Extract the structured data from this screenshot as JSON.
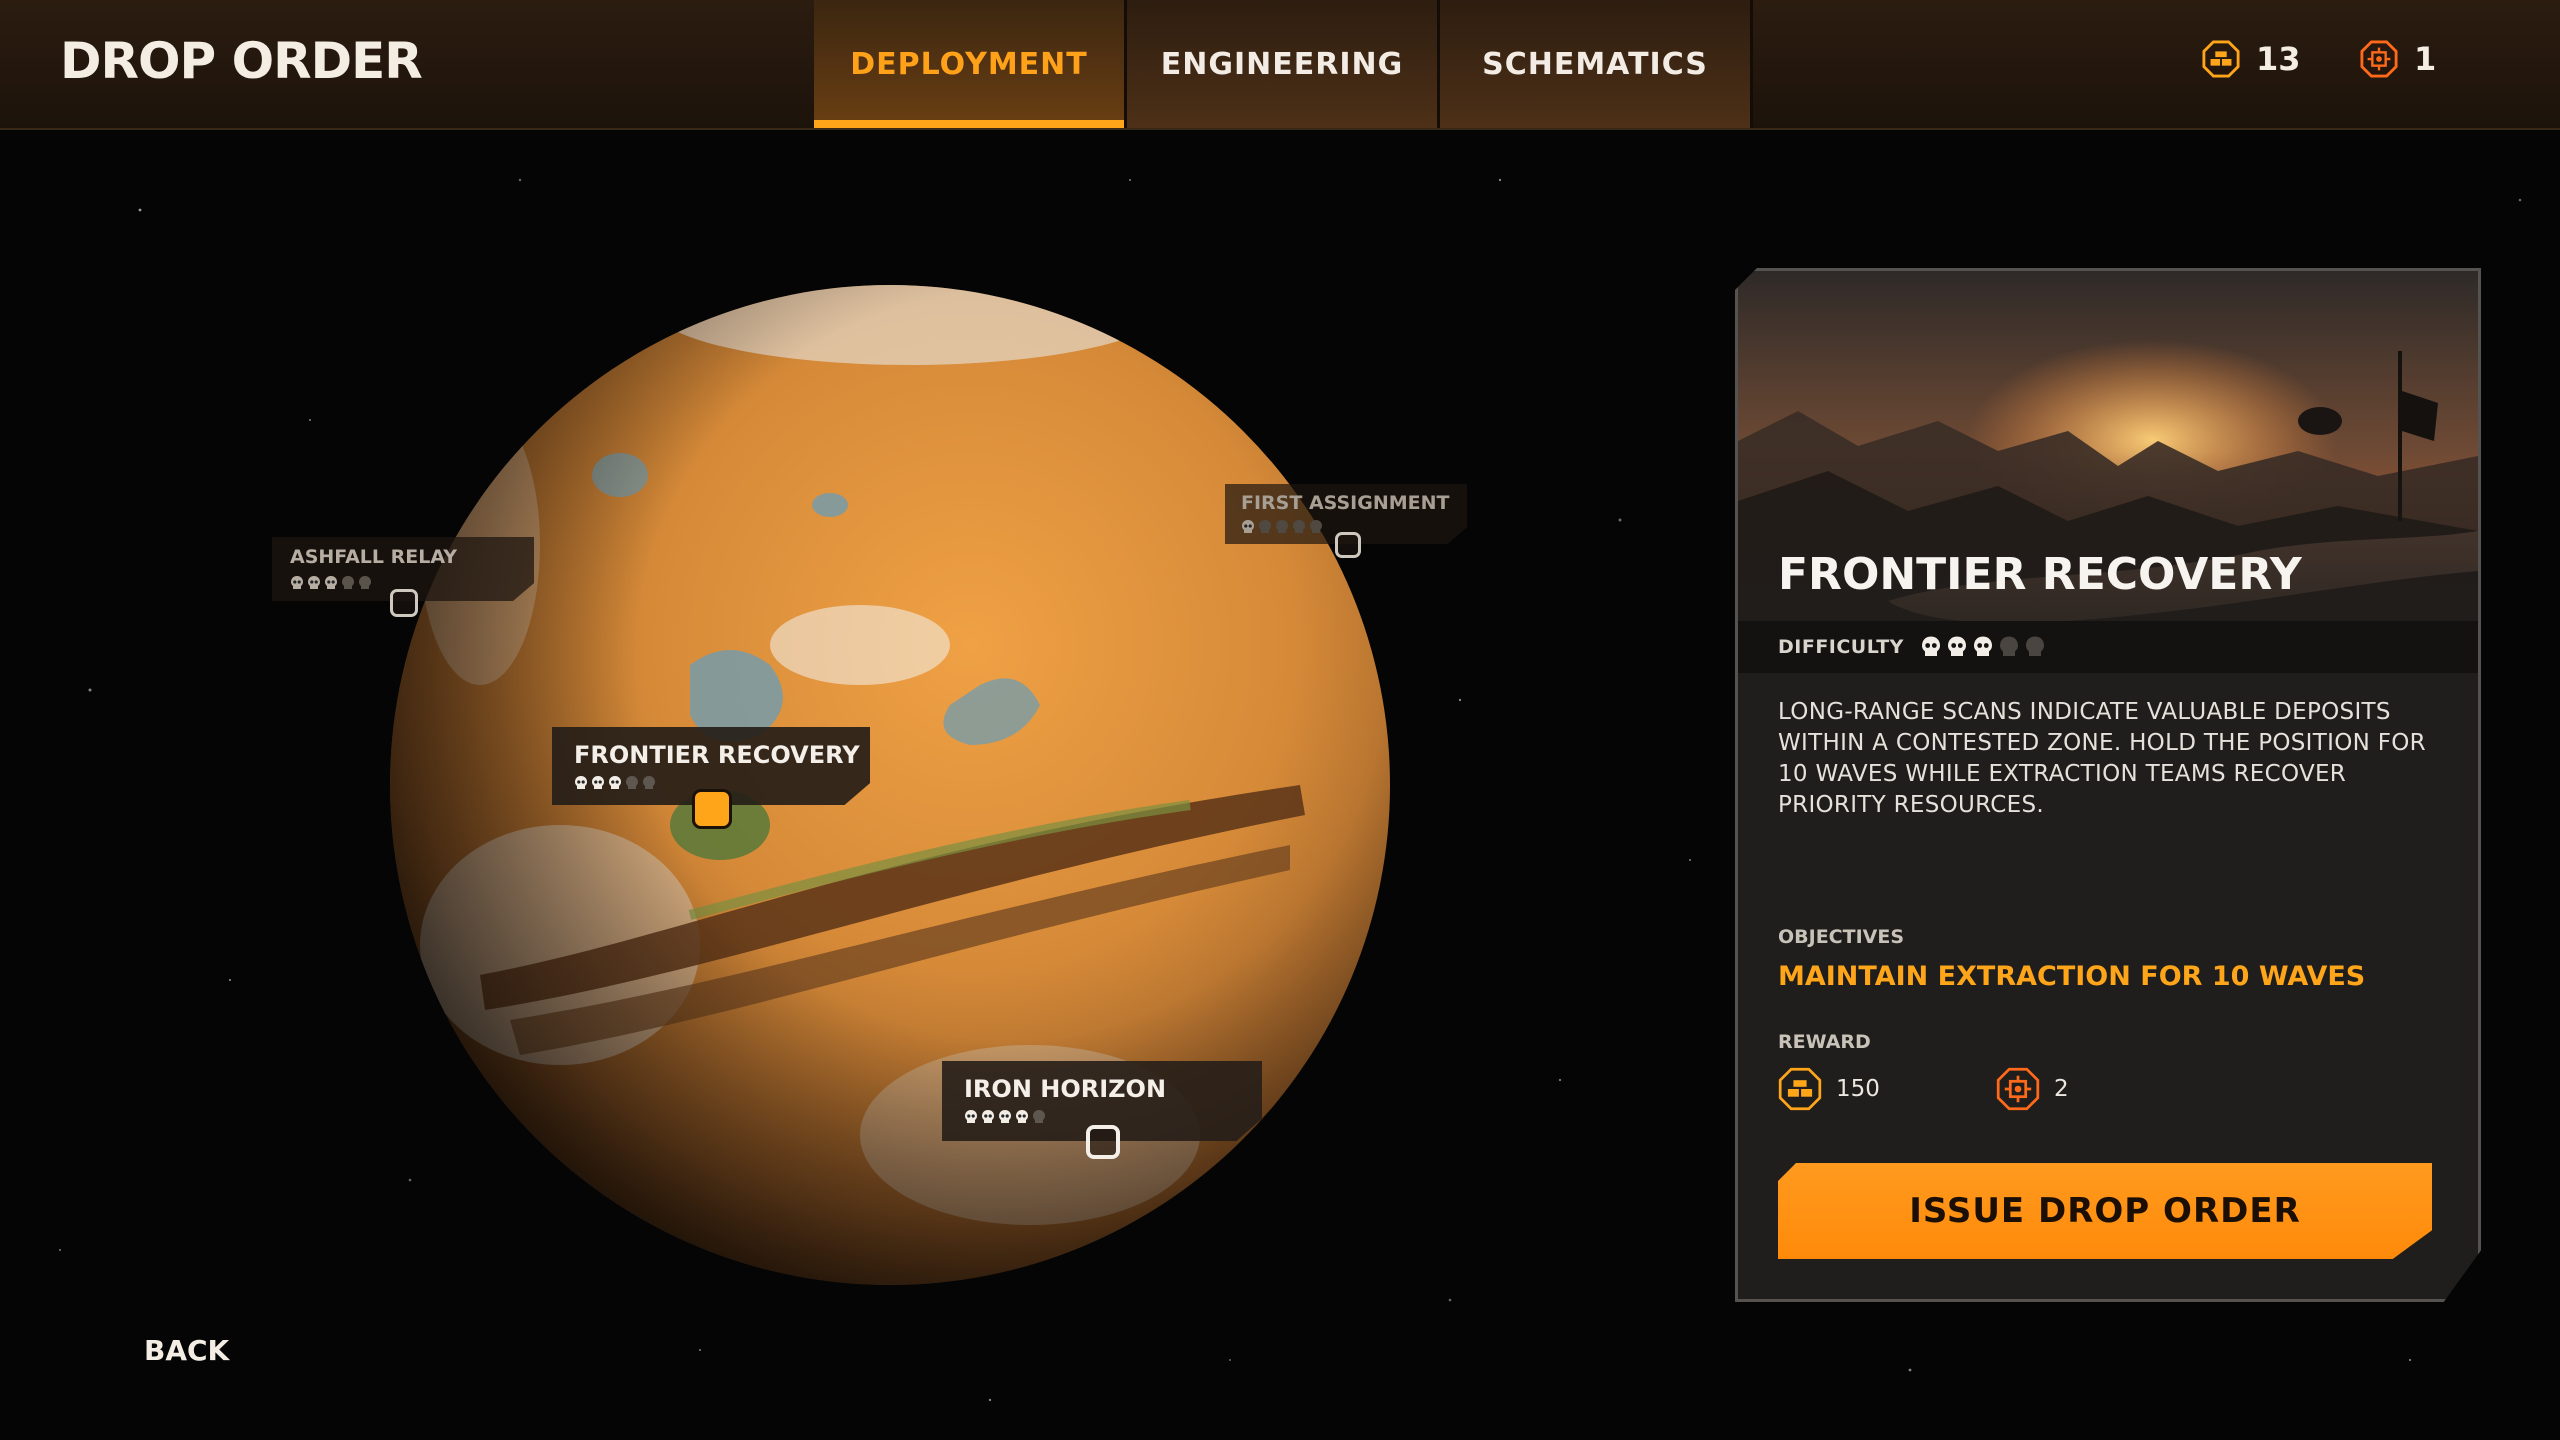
{
  "app": {
    "title": "DROP ORDER"
  },
  "tabs": [
    {
      "label": "DEPLOYMENT",
      "active": true
    },
    {
      "label": "ENGINEERING",
      "active": false
    },
    {
      "label": "SCHEMATICS",
      "active": false
    }
  ],
  "currencies": [
    {
      "icon": "gold-bars-icon",
      "value": "13",
      "color": "#ffa51a"
    },
    {
      "icon": "core-chip-icon",
      "value": "1",
      "color": "#ff6a1a"
    }
  ],
  "map": {
    "planet": "mars-like-planet",
    "locations": [
      {
        "name": "ASHFALL RELAY",
        "difficulty": 3,
        "max_difficulty": 5,
        "selected": false
      },
      {
        "name": "FIRST ASSIGNMENT",
        "difficulty": 1,
        "max_difficulty": 5,
        "selected": false
      },
      {
        "name": "FRONTIER RECOVERY",
        "difficulty": 3,
        "max_difficulty": 5,
        "selected": true
      },
      {
        "name": "IRON HORIZON",
        "difficulty": 4,
        "max_difficulty": 5,
        "selected": false
      }
    ]
  },
  "mission": {
    "title": "FRONTIER RECOVERY",
    "difficulty_label": "DIFFICULTY",
    "difficulty": 3,
    "max_difficulty": 5,
    "description": "LONG-RANGE SCANS INDICATE VALUABLE DEPOSITS WITHIN A CONTESTED ZONE. HOLD THE POSITION FOR 10 WAVES WHILE EXTRACTION TEAMS RECOVER PRIORITY RESOURCES.",
    "objectives_label": "OBJECTIVES",
    "objective": "MAINTAIN EXTRACTION FOR 10 WAVES",
    "reward_label": "REWARD",
    "rewards": [
      {
        "icon": "gold-bars-icon",
        "value": "150"
      },
      {
        "icon": "core-chip-icon",
        "value": "2"
      }
    ],
    "action_label": "ISSUE DROP ORDER"
  },
  "back_label": "BACK",
  "colors": {
    "accent": "#ffa51a",
    "panel": "#1f1e1c",
    "topbar": "#2c1c10"
  }
}
